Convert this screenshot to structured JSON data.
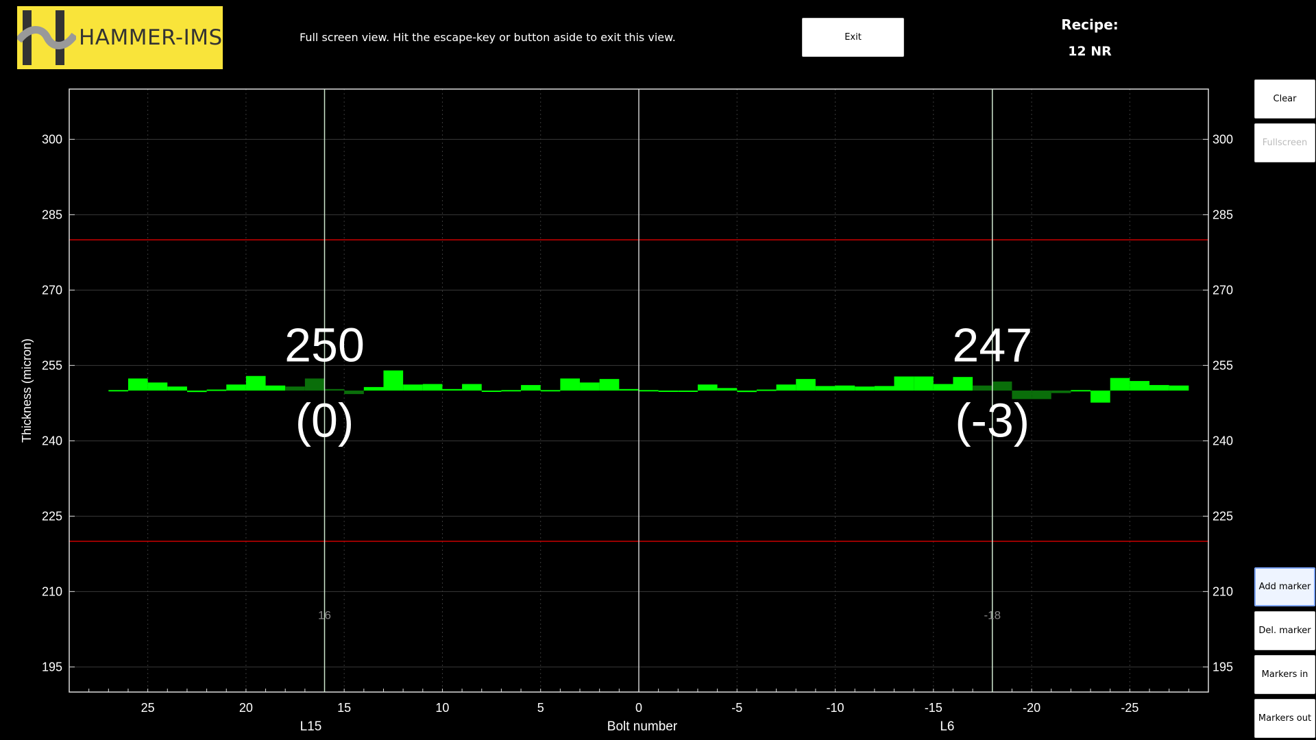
{
  "header": {
    "brand": "HAMMER-IMS",
    "notice": "Full screen view. Hit the escape-key or button aside to exit this view.",
    "exit_label": "Exit",
    "recipe_label": "Recipe:",
    "recipe_value": "12 NR"
  },
  "sidebar": {
    "clear": "Clear",
    "fullscreen": "Fullscreen",
    "add_marker": "Add marker",
    "del_marker": "Del. marker",
    "markers_in": "Markers in",
    "markers_out": "Markers out"
  },
  "colors": {
    "bar": "#00ff00",
    "bar_dark": "#0a6e0a",
    "limit": "#cc0000",
    "grid": "#3a3a3a",
    "marker": "#cfe8cf"
  },
  "chart_data": {
    "type": "bar",
    "ylabel": "Thickness (micron)",
    "xlabel": "Bolt number",
    "ylim": [
      190,
      310
    ],
    "xlim": [
      29,
      -29
    ],
    "yticks": [
      195,
      210,
      225,
      240,
      255,
      270,
      285,
      300
    ],
    "xticks": [
      25,
      20,
      15,
      10,
      5,
      0,
      -5,
      -10,
      -15,
      -20,
      -25
    ],
    "zone_labels": [
      {
        "x": 16.7,
        "text": "L15"
      },
      {
        "x": -15.7,
        "text": "L6"
      }
    ],
    "baseline": 250,
    "limits": {
      "upper": 280,
      "lower": 220
    },
    "grid": true,
    "center_line_x": 0,
    "markers": [
      {
        "x": 16,
        "label": "16",
        "value": "250",
        "delta": "(0)"
      },
      {
        "x": -18,
        "label": "-18",
        "value": "247",
        "delta": "(-3)"
      }
    ],
    "x_start": 27,
    "bin_width": 1,
    "values": [
      250.1,
      252.4,
      251.6,
      250.8,
      249.7,
      250.2,
      251.2,
      252.9,
      251.0,
      250.8,
      252.4,
      250.3,
      249.3,
      250.7,
      254.0,
      251.2,
      251.3,
      250.3,
      251.3,
      250.0,
      250.1,
      251.1,
      250.1,
      252.4,
      251.6,
      252.3,
      250.3,
      250.1,
      250.0,
      249.9,
      251.2,
      250.5,
      249.7,
      250.2,
      251.2,
      252.3,
      250.9,
      251.0,
      250.8,
      250.9,
      252.8,
      252.8,
      251.3,
      252.7,
      251.0,
      251.8,
      248.3,
      248.3,
      249.5,
      250.1,
      247.6,
      252.5,
      251.9,
      251.1,
      251.0
    ],
    "dark_bins": [
      9,
      10,
      11,
      12,
      44,
      45,
      46,
      47,
      48
    ]
  }
}
